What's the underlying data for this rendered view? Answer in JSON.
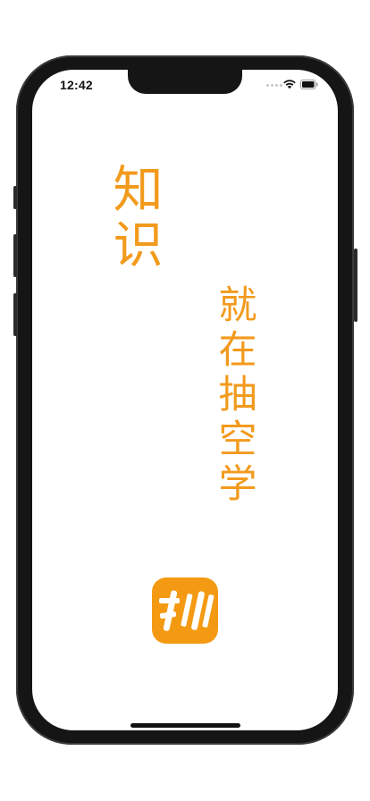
{
  "status_bar": {
    "time": "12:42",
    "signal_icon": "signal-dots-icon",
    "wifi_icon": "wifi-icon",
    "battery_icon": "battery-icon"
  },
  "splash": {
    "headline": "知识",
    "tagline": "就在抽空学"
  },
  "app_logo": {
    "icon": "app-logo-icon",
    "accent_color": "#f49a12"
  },
  "text_color": "#f29a1c"
}
